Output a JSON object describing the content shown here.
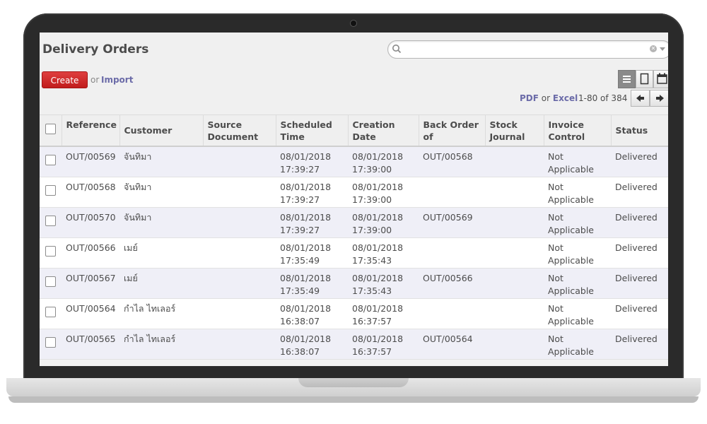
{
  "control_panel": {
    "title": "Delivery Orders",
    "search_placeholder": "",
    "create_label": "Create",
    "or_label": "or",
    "import_label": "Import",
    "export": {
      "pdf": "PDF",
      "or": "or",
      "excel": "Excel"
    },
    "pager_value": "1-80 of 384"
  },
  "table": {
    "columns": [
      "Reference",
      "Customer",
      "Source Document",
      "Scheduled Time",
      "Creation Date",
      "Back Order of",
      "Stock Journal",
      "Invoice Control",
      "Status"
    ],
    "rows": [
      {
        "reference": "OUT/00569",
        "customer": "จันทิมา",
        "source": "",
        "scheduled": "08/01/2018 17:39:27",
        "created": "08/01/2018 17:39:00",
        "backorder": "OUT/00568",
        "journal": "",
        "invoice": "Not Applicable",
        "status": "Delivered"
      },
      {
        "reference": "OUT/00568",
        "customer": "จันทิมา",
        "source": "",
        "scheduled": "08/01/2018 17:39:27",
        "created": "08/01/2018 17:39:00",
        "backorder": "",
        "journal": "",
        "invoice": "Not Applicable",
        "status": "Delivered"
      },
      {
        "reference": "OUT/00570",
        "customer": "จันทิมา",
        "source": "",
        "scheduled": "08/01/2018 17:39:27",
        "created": "08/01/2018 17:39:00",
        "backorder": "OUT/00569",
        "journal": "",
        "invoice": "Not Applicable",
        "status": "Delivered"
      },
      {
        "reference": "OUT/00566",
        "customer": "เมย์",
        "source": "",
        "scheduled": "08/01/2018 17:35:49",
        "created": "08/01/2018 17:35:43",
        "backorder": "",
        "journal": "",
        "invoice": "Not Applicable",
        "status": "Delivered"
      },
      {
        "reference": "OUT/00567",
        "customer": "เมย์",
        "source": "",
        "scheduled": "08/01/2018 17:35:49",
        "created": "08/01/2018 17:35:43",
        "backorder": "OUT/00566",
        "journal": "",
        "invoice": "Not Applicable",
        "status": "Delivered"
      },
      {
        "reference": "OUT/00564",
        "customer": "กำไล ไทเลอร์",
        "source": "",
        "scheduled": "08/01/2018 16:38:07",
        "created": "08/01/2018 16:37:57",
        "backorder": "",
        "journal": "",
        "invoice": "Not Applicable",
        "status": "Delivered"
      },
      {
        "reference": "OUT/00565",
        "customer": "กำไล ไทเลอร์",
        "source": "",
        "scheduled": "08/01/2018 16:38:07",
        "created": "08/01/2018 16:37:57",
        "backorder": "OUT/00564",
        "journal": "",
        "invoice": "Not Applicable",
        "status": "Delivered"
      }
    ]
  },
  "colors": {
    "create_button": "#d22b2b",
    "link": "#6b6ba8",
    "late_row": "#e02020",
    "odd_row": "#efeff7"
  }
}
